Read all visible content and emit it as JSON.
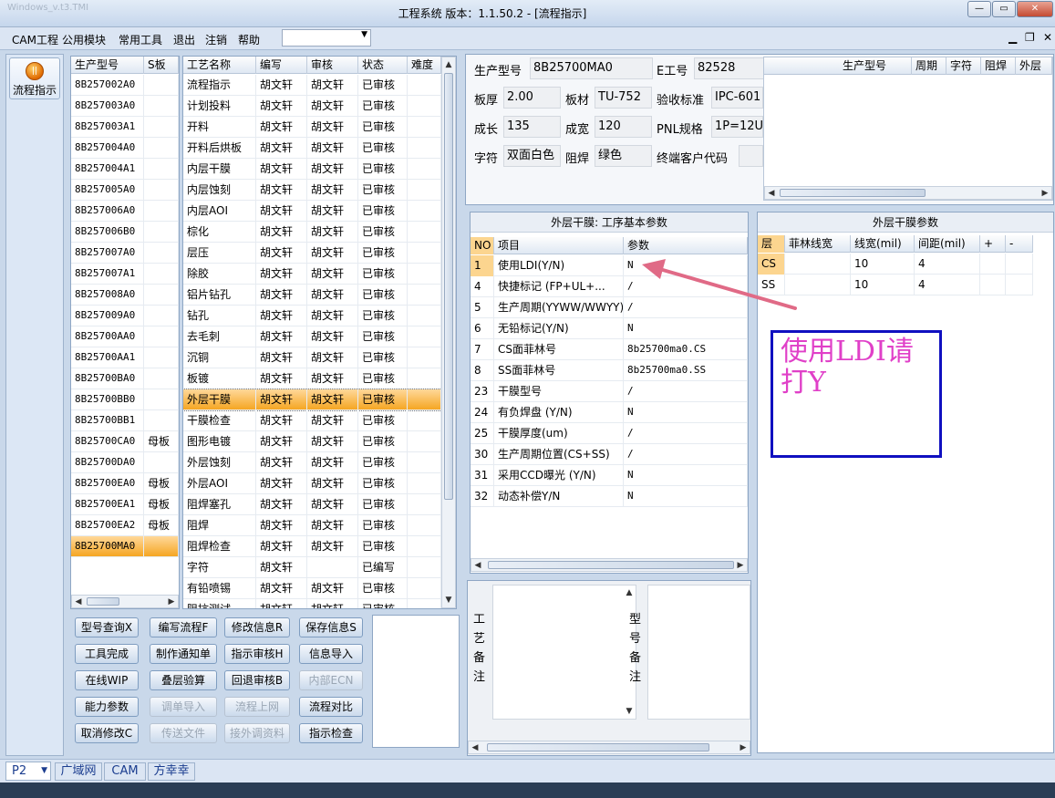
{
  "window": {
    "title": "工程系统   版本：1.1.50.2 - [流程指示]",
    "ghost_title": "Windows_v.t3.TMI"
  },
  "menu": {
    "items": [
      "CAM工程",
      "公用模块",
      "常用工具",
      "退出",
      "注销",
      "帮助"
    ]
  },
  "sidebar": {
    "flow_button": "流程指示"
  },
  "model_list": {
    "headers": [
      "生产型号",
      "S板"
    ],
    "rows": [
      [
        "8B257002A0",
        ""
      ],
      [
        "8B257003A0",
        ""
      ],
      [
        "8B257003A1",
        ""
      ],
      [
        "8B257004A0",
        ""
      ],
      [
        "8B257004A1",
        ""
      ],
      [
        "8B257005A0",
        ""
      ],
      [
        "8B257006A0",
        ""
      ],
      [
        "8B257006B0",
        ""
      ],
      [
        "8B257007A0",
        ""
      ],
      [
        "8B257007A1",
        ""
      ],
      [
        "8B257008A0",
        ""
      ],
      [
        "8B257009A0",
        ""
      ],
      [
        "8B25700AA0",
        ""
      ],
      [
        "8B25700AA1",
        ""
      ],
      [
        "8B25700BA0",
        ""
      ],
      [
        "8B25700BB0",
        ""
      ],
      [
        "8B25700BB1",
        ""
      ],
      [
        "8B25700CA0",
        "母板"
      ],
      [
        "8B25700DA0",
        ""
      ],
      [
        "8B25700EA0",
        "母板"
      ],
      [
        "8B25700EA1",
        "母板"
      ],
      [
        "8B25700EA2",
        "母板"
      ],
      [
        "8B25700MA0",
        ""
      ]
    ],
    "selected": 22
  },
  "process_list": {
    "headers": [
      "工艺名称",
      "编写",
      "审核",
      "状态",
      "难度"
    ],
    "rows": [
      [
        "流程指示",
        "胡文轩",
        "胡文轩",
        "已审核"
      ],
      [
        "计划投料",
        "胡文轩",
        "胡文轩",
        "已审核"
      ],
      [
        "开料",
        "胡文轩",
        "胡文轩",
        "已审核"
      ],
      [
        "开料后烘板",
        "胡文轩",
        "胡文轩",
        "已审核"
      ],
      [
        "内层干膜",
        "胡文轩",
        "胡文轩",
        "已审核"
      ],
      [
        "内层蚀刻",
        "胡文轩",
        "胡文轩",
        "已审核"
      ],
      [
        "内层AOI",
        "胡文轩",
        "胡文轩",
        "已审核"
      ],
      [
        "棕化",
        "胡文轩",
        "胡文轩",
        "已审核"
      ],
      [
        "层压",
        "胡文轩",
        "胡文轩",
        "已审核"
      ],
      [
        "除胶",
        "胡文轩",
        "胡文轩",
        "已审核"
      ],
      [
        "铝片钻孔",
        "胡文轩",
        "胡文轩",
        "已审核"
      ],
      [
        "钻孔",
        "胡文轩",
        "胡文轩",
        "已审核"
      ],
      [
        "去毛刺",
        "胡文轩",
        "胡文轩",
        "已审核"
      ],
      [
        "沉铜",
        "胡文轩",
        "胡文轩",
        "已审核"
      ],
      [
        "板镀",
        "胡文轩",
        "胡文轩",
        "已审核"
      ],
      [
        "外层干膜",
        "胡文轩",
        "胡文轩",
        "已审核"
      ],
      [
        "干膜检查",
        "胡文轩",
        "胡文轩",
        "已审核"
      ],
      [
        "图形电镀",
        "胡文轩",
        "胡文轩",
        "已审核"
      ],
      [
        "外层蚀刻",
        "胡文轩",
        "胡文轩",
        "已审核"
      ],
      [
        "外层AOI",
        "胡文轩",
        "胡文轩",
        "已审核"
      ],
      [
        "阻焊塞孔",
        "胡文轩",
        "胡文轩",
        "已审核"
      ],
      [
        "阻焊",
        "胡文轩",
        "胡文轩",
        "已审核"
      ],
      [
        "阻焊检查",
        "胡文轩",
        "胡文轩",
        "已审核"
      ],
      [
        "字符",
        "胡文轩",
        "",
        "已编写"
      ],
      [
        "有铅喷锡",
        "胡文轩",
        "胡文轩",
        "已审核"
      ],
      [
        "阻抗测试",
        "胡文轩",
        "胡文轩",
        "已审核"
      ]
    ],
    "selected": 15
  },
  "buttons": [
    {
      "label": "型号查询X",
      "enabled": true
    },
    {
      "label": "编写流程F",
      "enabled": true
    },
    {
      "label": "修改信息R",
      "enabled": true
    },
    {
      "label": "保存信息S",
      "enabled": true
    },
    {
      "label": "工具完成",
      "enabled": true
    },
    {
      "label": "制作通知单",
      "enabled": true
    },
    {
      "label": "指示审核H",
      "enabled": true
    },
    {
      "label": "信息导入",
      "enabled": true
    },
    {
      "label": "在线WIP",
      "enabled": true
    },
    {
      "label": "叠层验算",
      "enabled": true
    },
    {
      "label": "回退审核B",
      "enabled": true
    },
    {
      "label": "内部ECN",
      "enabled": false
    },
    {
      "label": "能力参数",
      "enabled": true
    },
    {
      "label": "调单导入",
      "enabled": false
    },
    {
      "label": "流程上网",
      "enabled": false
    },
    {
      "label": "流程对比",
      "enabled": true
    },
    {
      "label": "取消修改C",
      "enabled": true
    },
    {
      "label": "传送文件",
      "enabled": false
    },
    {
      "label": "接外调资料",
      "enabled": false
    },
    {
      "label": "指示检查",
      "enabled": true
    }
  ],
  "info": {
    "model_label": "生产型号",
    "model_value": "8B25700MA0",
    "e_label": "E工号",
    "e_value": "82528",
    "thick_label": "板厚",
    "thick_value": "2.00",
    "material_label": "板材",
    "material_value": "TU-752",
    "standard_label": "验收标准",
    "standard_value": "IPC-601",
    "length_label": "成长",
    "length_value": "135",
    "width_label": "成宽",
    "width_value": "120",
    "pnl_label": "PNL规格",
    "pnl_value": "1P=12U",
    "char_label": "字符",
    "char_value": "双面白色",
    "mask_label": "阻焊",
    "mask_value": "绿色",
    "customer_label": "终端客户代码",
    "customer_value": ""
  },
  "top_right_grid": {
    "headers": [
      "生产型号",
      "周期",
      "字符",
      "阻焊",
      "外层"
    ]
  },
  "params": {
    "title": "外层干膜: 工序基本参数",
    "headers": [
      "NO",
      "项目",
      "参数"
    ],
    "rows": [
      [
        "1",
        "使用LDI(Y/N)",
        "N"
      ],
      [
        "4",
        "快捷标记 (FP+UL+...",
        "/"
      ],
      [
        "5",
        "生产周期(YYWW/WWYY)",
        "/"
      ],
      [
        "6",
        "无铅标记(Y/N)",
        "N"
      ],
      [
        "7",
        "CS面菲林号",
        "8b25700ma0.CS"
      ],
      [
        "8",
        "SS面菲林号",
        "8b25700ma0.SS"
      ],
      [
        "23",
        "干膜型号",
        "/"
      ],
      [
        "24",
        "有负焊盘 (Y/N)",
        "N"
      ],
      [
        "25",
        "干膜厚度(um)",
        "/"
      ],
      [
        "30",
        "生产周期位置(CS+SS)",
        "/"
      ],
      [
        "31",
        "采用CCD曝光 (Y/N)",
        "N"
      ],
      [
        "32",
        "动态补偿Y/N",
        "N"
      ]
    ]
  },
  "film_params": {
    "title": "外层干膜参数",
    "headers": [
      "层",
      "菲林线宽",
      "线宽(mil)",
      "间距(mil)",
      "+",
      "-"
    ],
    "rows": [
      [
        "CS",
        "",
        "10",
        "4"
      ],
      [
        "SS",
        "",
        "10",
        "4"
      ]
    ]
  },
  "annotation": {
    "text": "使用LDI请打Y",
    "color": "#e040c8",
    "border": "#1010c0"
  },
  "notes": {
    "process_label": "工艺备注",
    "model_label": "型号备注"
  },
  "statusbar": {
    "combo": "P2",
    "items": [
      "广域网",
      "CAM",
      "方幸幸"
    ]
  }
}
